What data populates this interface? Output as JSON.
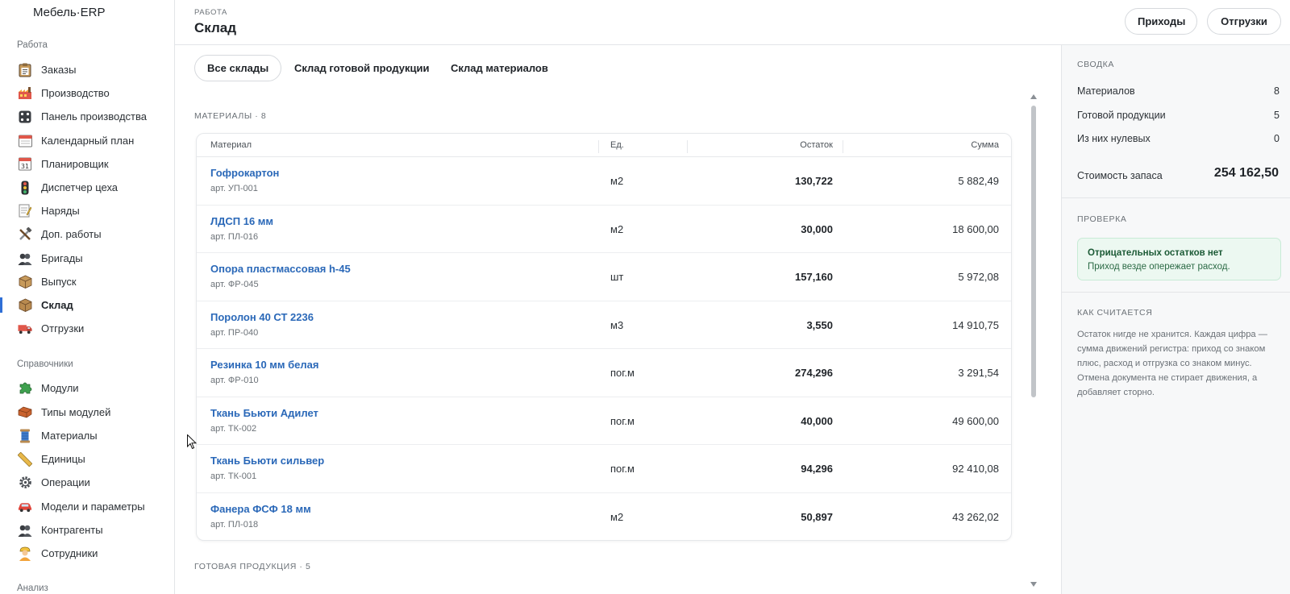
{
  "app": {
    "brand": "Мебель·ERP"
  },
  "sidebar": {
    "sections": [
      {
        "label": "Работа"
      },
      {
        "label": "Справочники"
      },
      {
        "label": "Анализ"
      }
    ],
    "work_items": [
      {
        "label": "Заказы",
        "icon": "clipboard-icon"
      },
      {
        "label": "Производство",
        "icon": "factory-icon"
      },
      {
        "label": "Панель производства",
        "icon": "dice-panel-icon"
      },
      {
        "label": "Календарный план",
        "icon": "calendar-icon"
      },
      {
        "label": "Планировщик",
        "icon": "calendar-31-icon"
      },
      {
        "label": "Диспетчер цеха",
        "icon": "traffic-light-icon"
      },
      {
        "label": "Наряды",
        "icon": "memo-icon"
      },
      {
        "label": "Доп. работы",
        "icon": "tools-icon"
      },
      {
        "label": "Бригады",
        "icon": "people-icon"
      },
      {
        "label": "Выпуск",
        "icon": "package-icon"
      },
      {
        "label": "Склад",
        "icon": "warehouse-box-icon",
        "active": true
      },
      {
        "label": "Отгрузки",
        "icon": "truck-icon"
      }
    ],
    "ref_items": [
      {
        "label": "Модули",
        "icon": "puzzle-icon"
      },
      {
        "label": "Типы модулей",
        "icon": "brick-icon"
      },
      {
        "label": "Материалы",
        "icon": "thread-icon"
      },
      {
        "label": "Единицы",
        "icon": "ruler-icon"
      },
      {
        "label": "Операции",
        "icon": "gear-icon"
      },
      {
        "label": "Модели и параметры",
        "icon": "car-icon"
      },
      {
        "label": "Контрагенты",
        "icon": "people-icon"
      },
      {
        "label": "Сотрудники",
        "icon": "worker-icon"
      }
    ]
  },
  "header": {
    "crumb": "РАБОТА",
    "title": "Склад",
    "buttons": {
      "incoming": "Приходы",
      "shipments": "Отгрузки"
    }
  },
  "tabs": [
    {
      "label": "Все склады",
      "active": true
    },
    {
      "label": "Склад готовой продукции"
    },
    {
      "label": "Склад материалов"
    }
  ],
  "materials": {
    "heading": "МАТЕРИАЛЫ · 8",
    "columns": {
      "material": "Материал",
      "unit": "Ед.",
      "qty": "Остаток",
      "sum": "Сумма"
    },
    "rows": [
      {
        "name": "Гофрокартон",
        "art": "арт. УП-001",
        "unit": "м2",
        "qty": "130,722",
        "sum": "5 882,49"
      },
      {
        "name": "ЛДСП 16 мм",
        "art": "арт. ПЛ-016",
        "unit": "м2",
        "qty": "30,000",
        "sum": "18 600,00"
      },
      {
        "name": "Опора пластмассовая h-45",
        "art": "арт. ФР-045",
        "unit": "шт",
        "qty": "157,160",
        "sum": "5 972,08"
      },
      {
        "name": "Поролон 40 СТ 2236",
        "art": "арт. ПР-040",
        "unit": "м3",
        "qty": "3,550",
        "sum": "14 910,75"
      },
      {
        "name": "Резинка 10 мм белая",
        "art": "арт. ФР-010",
        "unit": "пог.м",
        "qty": "274,296",
        "sum": "3 291,54"
      },
      {
        "name": "Ткань Бьюти Адилет",
        "art": "арт. ТК-002",
        "unit": "пог.м",
        "qty": "40,000",
        "sum": "49 600,00"
      },
      {
        "name": "Ткань Бьюти сильвер",
        "art": "арт. ТК-001",
        "unit": "пог.м",
        "qty": "94,296",
        "sum": "92 410,08"
      },
      {
        "name": "Фанера ФСФ 18 мм",
        "art": "арт. ПЛ-018",
        "unit": "м2",
        "qty": "50,897",
        "sum": "43 262,02"
      }
    ]
  },
  "finished": {
    "heading": "ГОТОВАЯ ПРОДУКЦИЯ · 5"
  },
  "summary": {
    "heading": "СВОДКА",
    "rows": [
      {
        "label": "Материалов",
        "value": "8"
      },
      {
        "label": "Готовой продукции",
        "value": "5"
      },
      {
        "label": "Из них нулевых",
        "value": "0"
      }
    ],
    "stock_label": "Стоимость запаса",
    "stock_value": "254 162,50"
  },
  "check": {
    "heading": "ПРОВЕРКА",
    "title": "Отрицательных остатков нет",
    "text": "Приход везде опережает расход."
  },
  "how": {
    "heading": "КАК СЧИТАЕТСЯ",
    "text": "Остаток нигде не хранится. Каждая цифра — сумма движений регистра: приход со знаком плюс, расход и отгрузка со знаком минус. Отмена документа не стирает движения, а добавляет сторно."
  },
  "colors": {
    "accent": "#2f6fd6",
    "link": "#2a68b8",
    "ok_bg": "#ecf8f1",
    "ok_text": "#1c5a36"
  }
}
